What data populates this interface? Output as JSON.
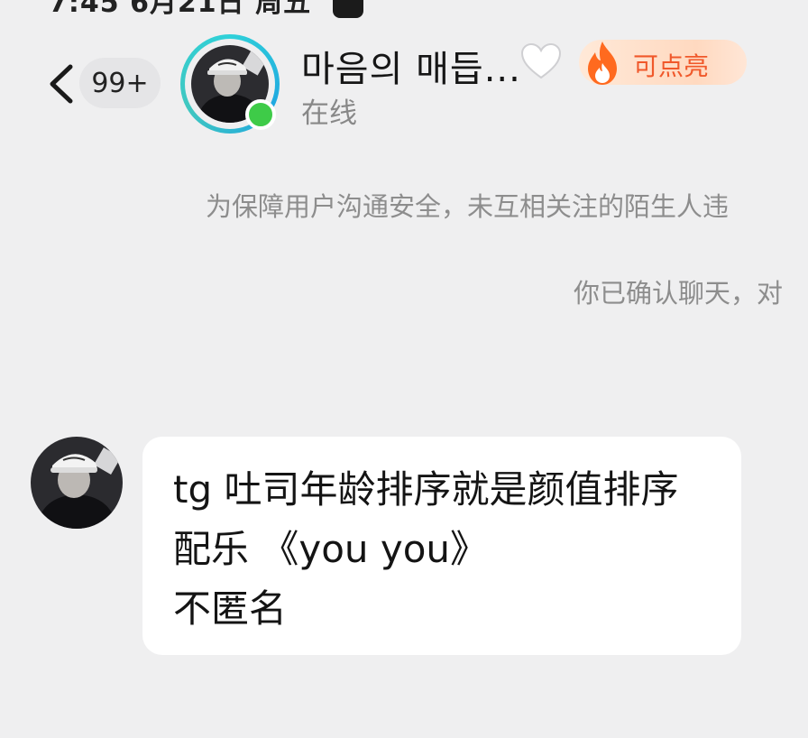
{
  "status_bar": {
    "text": "7:45  6月21日 周五"
  },
  "header": {
    "back_icon": "chevron-left-icon",
    "unread_count": "99+",
    "contact_name": "마음의 매듭...",
    "name_badge_icon": "white-heart-icon",
    "spark": {
      "icon": "flame-icon",
      "label": "可点亮",
      "color": "#f0582a"
    },
    "presence": "在线",
    "online_color": "#3ecb48"
  },
  "notices": [
    "为保障用户沟通安全，未互相关注的陌生人违",
    "你已确认聊天，对"
  ],
  "messages": [
    {
      "direction": "incoming",
      "lines": [
        "tg 吐司年龄排序就是颜值排序",
        "配乐 《you you》",
        "不匿名"
      ]
    }
  ]
}
